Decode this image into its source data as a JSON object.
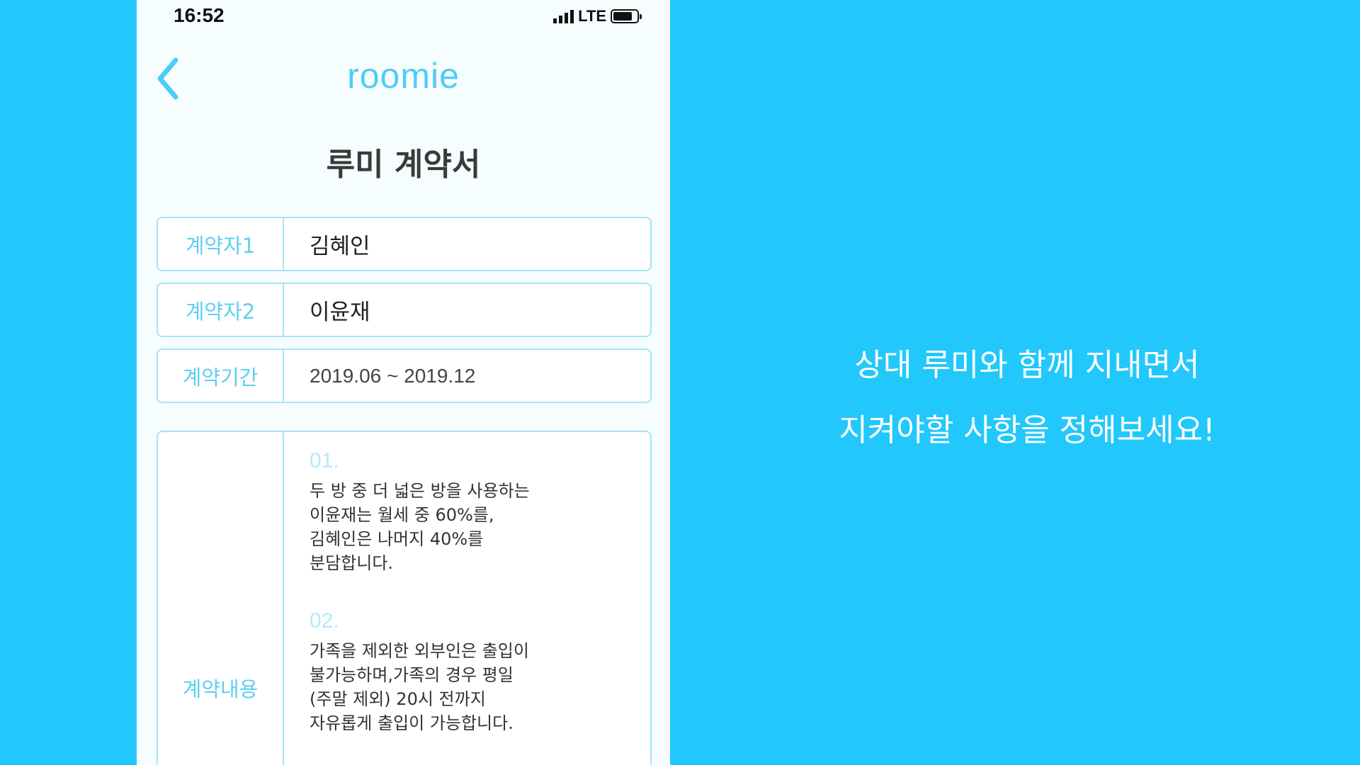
{
  "status_bar": {
    "time": "16:52",
    "network": "LTE"
  },
  "header": {
    "back_icon": "chevron-left-icon",
    "app_name": "roomie"
  },
  "contract": {
    "title": "루미 계약서",
    "fields": [
      {
        "label": "계약자1",
        "value": "김혜인"
      },
      {
        "label": "계약자2",
        "value": "이윤재"
      },
      {
        "label": "계약기간",
        "value": "2019.06 ~ 2019.12"
      }
    ],
    "content_label": "계약내용",
    "clauses": [
      {
        "num": "01.",
        "text": "두 방 중 더 넓은 방을 사용하는\n이윤재는 월세 중 60%를,\n김혜인은 나머지 40%를\n분담합니다."
      },
      {
        "num": "02.",
        "text": "가족을 제외한 외부인은 출입이\n불가능하며,가족의 경우 평일\n(주말 제외) 20시 전까지\n자유롭게 출입이 가능합니다."
      }
    ]
  },
  "caption": {
    "line1": "상대 루미와 함께 지내면서",
    "line2": "지켜야할 사항을 정해보세요!"
  },
  "colors": {
    "background": "#22c8fb",
    "accent": "#5fcff2",
    "border": "#a6e5f7"
  }
}
